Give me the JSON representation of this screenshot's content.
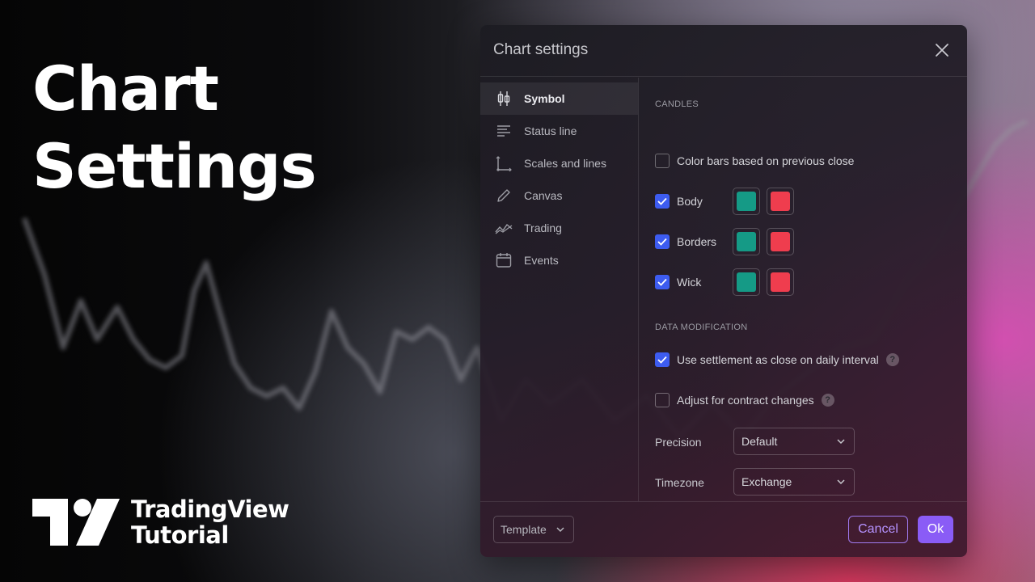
{
  "hero": {
    "line1": "Chart",
    "line2": "Settings"
  },
  "brand": {
    "line1": "TradingView",
    "line2": "Tutorial"
  },
  "dialog": {
    "title": "Chart settings",
    "sidebar": [
      {
        "label": "Symbol",
        "icon": "candles-icon",
        "active": true
      },
      {
        "label": "Status line",
        "icon": "status-line-icon",
        "active": false
      },
      {
        "label": "Scales and lines",
        "icon": "scales-icon",
        "active": false
      },
      {
        "label": "Canvas",
        "icon": "pencil-icon",
        "active": false
      },
      {
        "label": "Trading",
        "icon": "trading-icon",
        "active": false
      },
      {
        "label": "Events",
        "icon": "calendar-icon",
        "active": false
      }
    ],
    "candles": {
      "section_label": "CANDLES",
      "color_bars": {
        "label": "Color bars based on previous close",
        "checked": false
      },
      "body": {
        "label": "Body",
        "checked": true,
        "up_color": "#159a86",
        "down_color": "#ef3d4e"
      },
      "borders": {
        "label": "Borders",
        "checked": true,
        "up_color": "#159a86",
        "down_color": "#ef3d4e"
      },
      "wick": {
        "label": "Wick",
        "checked": true,
        "up_color": "#159a86",
        "down_color": "#ef3d4e"
      }
    },
    "data_modification": {
      "section_label": "DATA MODIFICATION",
      "settlement": {
        "label": "Use settlement as close on daily interval",
        "checked": true,
        "help": "?"
      },
      "contract": {
        "label": "Adjust for contract changes",
        "checked": false,
        "help": "?"
      },
      "precision": {
        "label": "Precision",
        "value": "Default"
      },
      "timezone": {
        "label": "Timezone",
        "value": "Exchange"
      }
    },
    "footer": {
      "template_label": "Template",
      "cancel_label": "Cancel",
      "ok_label": "Ok"
    }
  },
  "colors": {
    "accent": "#8a5cf6",
    "checkbox": "#3d5cf0"
  }
}
